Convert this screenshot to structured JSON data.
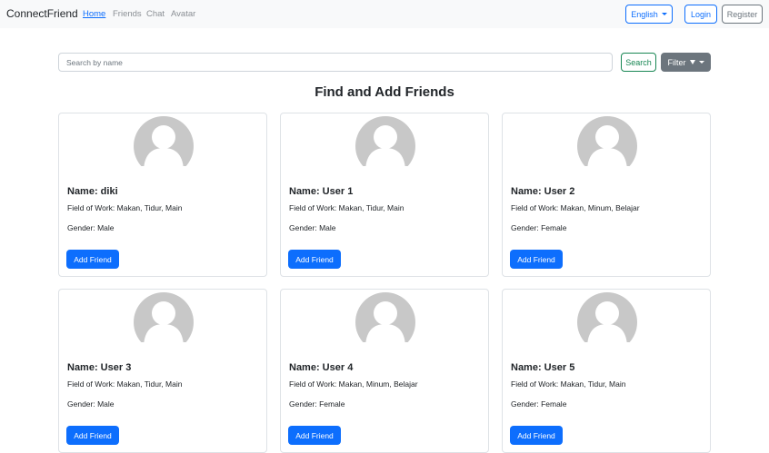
{
  "navbar": {
    "brand": "ConnectFriend",
    "links": [
      "Home",
      "Friends",
      "Chat",
      "Avatar"
    ],
    "language": "English",
    "login": "Login",
    "register": "Register"
  },
  "search": {
    "placeholder": "Search by name",
    "button": "Search",
    "filter": "Filter"
  },
  "page_title": "Find and Add Friends",
  "cards": [
    {
      "name": "Name: diki",
      "field": "Field of Work: Makan, Tidur, Main",
      "gender": "Gender: Male",
      "button": "Add Friend"
    },
    {
      "name": "Name: User 1",
      "field": "Field of Work: Makan, Tidur, Main",
      "gender": "Gender: Male",
      "button": "Add Friend"
    },
    {
      "name": "Name: User 2",
      "field": "Field of Work: Makan, Minum, Belajar",
      "gender": "Gender: Female",
      "button": "Add Friend"
    },
    {
      "name": "Name: User 3",
      "field": "Field of Work: Makan, Tidur, Main",
      "gender": "Gender: Male",
      "button": "Add Friend"
    },
    {
      "name": "Name: User 4",
      "field": "Field of Work: Makan, Minum, Belajar",
      "gender": "Gender: Female",
      "button": "Add Friend"
    },
    {
      "name": "Name: User 5",
      "field": "Field of Work: Makan, Tidur, Main",
      "gender": "Gender: Female",
      "button": "Add Friend"
    }
  ],
  "icons": {
    "avatar": "default-avatar-icon",
    "filter": "filter-funnel-icon",
    "caret": "caret-down-icon"
  },
  "colors": {
    "primary": "#0d6efd",
    "success": "#198754",
    "secondary": "#6c757d",
    "avatar_gray": "#c8c8c8"
  }
}
